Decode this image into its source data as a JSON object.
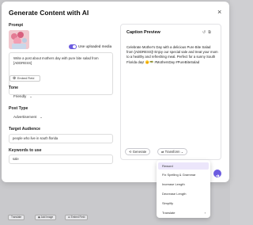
{
  "modal": {
    "title": "Generate Content with AI",
    "close_icon": "×"
  },
  "form": {
    "prompt_label": "Prompt",
    "use_media_label": "Use uploaded media",
    "prompt_text": "Write a post about mothers day with pure bite salad from [ADDRESS]",
    "embed_label": "Embed Field",
    "tone_label": "Tone",
    "tone_value": "Friendly",
    "post_type_label": "Post Type",
    "post_type_value": "Advertisement",
    "audience_label": "Target Audience",
    "audience_value": "people who live in south florida",
    "keywords_label": "Keywords to use",
    "keywords_value": "sale"
  },
  "preview": {
    "title": "Caption Preview",
    "text": "Celebrate Mother's Day with a delicious Pure Bite Salad from [ADDRESS]! Enjoy our special sale and treat your mom to a healthy and refreshing meal. Perfect for a sunny South Florida day! 🌞🥗 #MothersDay #PureBiteSalad",
    "generate_label": "Generate",
    "transform_label": "Transform"
  },
  "transform_menu": {
    "items": [
      "Reword",
      "Fix Spelling & Grammar",
      "Increase Length",
      "Decrease Length",
      "Simplify",
      "Translate"
    ],
    "active_index": 0
  },
  "footer": {
    "buttons": [
      "Translate",
      "Add Image",
      "Embed Field"
    ]
  },
  "icons": {
    "media_thumbnail": "image-thumbnail",
    "undo": "undo-icon",
    "copy": "copy-icon",
    "send": "send-icon"
  },
  "colors": {
    "accent": "#6b5be0",
    "menu_active_bg": "#ece6fb"
  }
}
